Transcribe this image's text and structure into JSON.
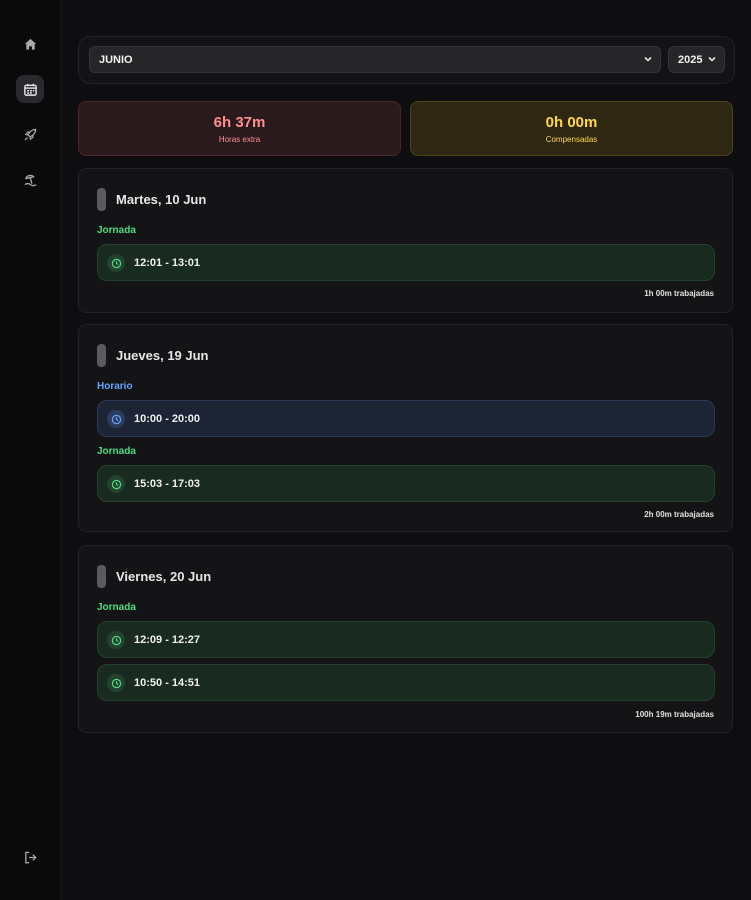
{
  "sidebar": {
    "items": [
      {
        "icon": "home-icon"
      },
      {
        "icon": "calendar-icon",
        "active": true
      },
      {
        "icon": "rocket-icon"
      },
      {
        "icon": "beach-umbrella-icon"
      }
    ],
    "logout_icon": "logout-icon"
  },
  "filters": {
    "month": "JUNIO",
    "year": "2025"
  },
  "stats": {
    "overtime": {
      "value": "6h 37m",
      "label": "Horas extra"
    },
    "compensated": {
      "value": "0h 00m",
      "label": "Compensadas"
    }
  },
  "days": [
    {
      "title": "Martes, 10 Jun",
      "sections": [
        {
          "label": "Jornada",
          "entries": [
            "12:01 - 13:01"
          ]
        }
      ],
      "worked": "1h 00m trabajadas"
    },
    {
      "title": "Jueves, 19 Jun",
      "sections": [
        {
          "label": "Horario",
          "entries": [
            "10:00 - 20:00"
          ]
        },
        {
          "label": "Jornada",
          "entries": [
            "15:03 - 17:03"
          ]
        }
      ],
      "worked": "2h 00m trabajadas"
    },
    {
      "title": "Viernes, 20 Jun",
      "sections": [
        {
          "label": "Jornada",
          "entries": [
            "12:09 - 12:27",
            "10:50 - 14:51"
          ]
        }
      ],
      "worked": "100h 19m trabajadas"
    }
  ],
  "colors": {
    "background": "#0e0e10",
    "overtime": "#ff8f8f",
    "compensated": "#ffd84a",
    "jornada": "#4ade80",
    "horario": "#60a5fa"
  }
}
